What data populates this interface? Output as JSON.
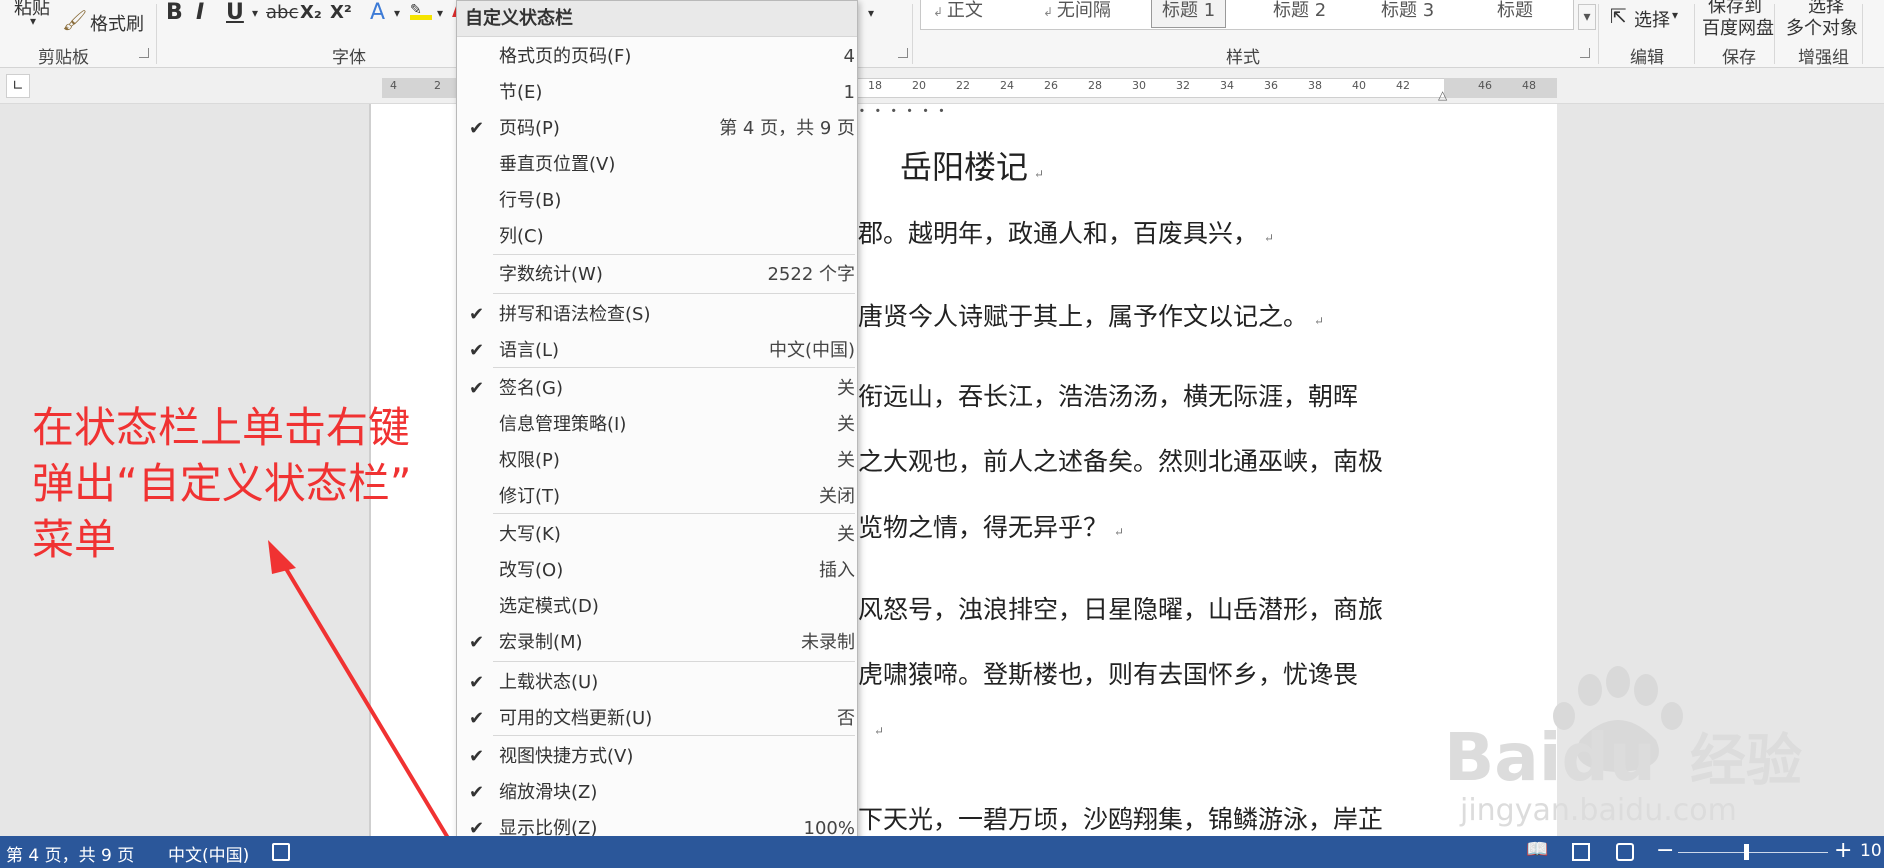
{
  "ribbon": {
    "paste_label": "粘贴",
    "format_painter_label": "格式刷",
    "clipboard_group": "剪贴板",
    "font_group": "字体",
    "styles_group": "样式",
    "editing_group": "编辑",
    "save_group": "保存",
    "enhance_group": "增强组",
    "select_label": "选择",
    "save_to_baidu_line1": "保存到",
    "save_to_baidu_line2": "百度网盘",
    "select_multi_line1": "选择",
    "select_multi_line2": "多个对象",
    "format_buttons": [
      "B",
      "I",
      "U",
      "abc",
      "X₂",
      "X²",
      "A"
    ],
    "styles": [
      "正文",
      "无间隔",
      "标题 1",
      "标题 2",
      "标题 3",
      "标题"
    ]
  },
  "ruler": {
    "numbers_left": [
      "4",
      "2"
    ],
    "numbers_right": [
      "18",
      "20",
      "22",
      "24",
      "26",
      "28",
      "30",
      "32",
      "34",
      "36",
      "38",
      "40",
      "42",
      "46",
      "48"
    ]
  },
  "document": {
    "title": "岳阳楼记",
    "lines": [
      "郡。越明年，政通人和，百废具兴，",
      "唐贤今人诗赋于其上，属予作文以记之。",
      "衔远山，吞长江，浩浩汤汤，横无际涯，朝晖",
      "之大观也，前人之述备矣。然则北通巫峡，南极",
      "览物之情，得无异乎？",
      "风怒号，浊浪排空，日星隐曜，山岳潜形，商旅",
      "虎啸猿啼。登斯楼也，则有去国怀乡，忧谗畏",
      "下天光，一碧万顷，沙鸥翔集，锦鳞游泳，岸芷"
    ]
  },
  "annotation": {
    "line1": "在状态栏上单击右键",
    "line2": "弹出“自定义状态栏”",
    "line3": "菜单"
  },
  "menu": {
    "title": "自定义状态栏",
    "items": [
      {
        "label": "格式页的页码(F)",
        "value": "4",
        "checked": false
      },
      {
        "label": "节(E)",
        "value": "1",
        "checked": false
      },
      {
        "label": "页码(P)",
        "value": "第 4 页，共 9 页",
        "checked": true
      },
      {
        "label": "垂直页位置(V)",
        "value": "",
        "checked": false
      },
      {
        "label": "行号(B)",
        "value": "",
        "checked": false
      },
      {
        "label": "列(C)",
        "value": "",
        "checked": false
      },
      {
        "label": "字数统计(W)",
        "value": "2522 个字",
        "checked": false
      },
      {
        "label": "拼写和语法检查(S)",
        "value": "",
        "checked": true
      },
      {
        "label": "语言(L)",
        "value": "中文(中国)",
        "checked": true
      },
      {
        "label": "签名(G)",
        "value": "关",
        "checked": true
      },
      {
        "label": "信息管理策略(I)",
        "value": "关",
        "checked": false
      },
      {
        "label": "权限(P)",
        "value": "关",
        "checked": false
      },
      {
        "label": "修订(T)",
        "value": "关闭",
        "checked": false
      },
      {
        "label": "大写(K)",
        "value": "关",
        "checked": false
      },
      {
        "label": "改写(O)",
        "value": "插入",
        "checked": false
      },
      {
        "label": "选定模式(D)",
        "value": "",
        "checked": false
      },
      {
        "label": "宏录制(M)",
        "value": "未录制",
        "checked": true
      },
      {
        "label": "上载状态(U)",
        "value": "",
        "checked": true
      },
      {
        "label": "可用的文档更新(U)",
        "value": "否",
        "checked": true
      },
      {
        "label": "视图快捷方式(V)",
        "value": "",
        "checked": true
      },
      {
        "label": "缩放滑块(Z)",
        "value": "",
        "checked": true
      },
      {
        "label": "显示比例(Z)",
        "value": "100%",
        "checked": true
      }
    ]
  },
  "statusbar": {
    "page": "第 4 页，共 9 页",
    "language": "中文(中国)",
    "zoom_minus": "−",
    "zoom_plus": "+",
    "zoom_value": "10",
    "zoom_slider_percent": 45
  },
  "watermark": {
    "brand": "Baidu",
    "product": "经验",
    "url": "jingyan.baidu.com"
  },
  "colors": {
    "statusbar": "#2b579a",
    "annotation": "#f03232",
    "menu_bg": "#fbfbfb"
  }
}
